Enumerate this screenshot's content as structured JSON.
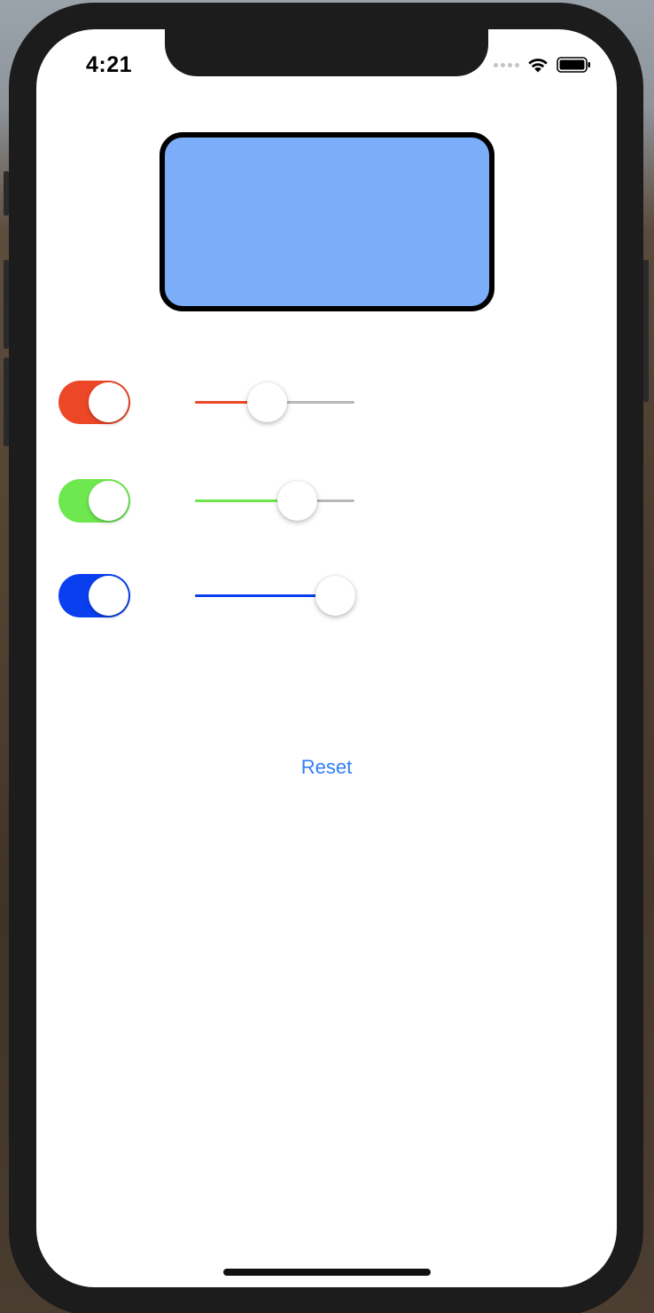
{
  "status_bar": {
    "time": "4:21",
    "signal_icon": "signal-dots-icon",
    "wifi_icon": "wifi-icon",
    "battery_icon": "battery-icon"
  },
  "preview": {
    "fill_color": "#7badf8",
    "border_color": "#000000"
  },
  "controls": [
    {
      "name": "red",
      "toggle_on": true,
      "accent_color": "#ec4727",
      "slider_value": 0.45
    },
    {
      "name": "green",
      "toggle_on": true,
      "accent_color": "#6de84f",
      "slider_value": 0.64
    },
    {
      "name": "blue",
      "toggle_on": true,
      "accent_color": "#0a3ff0",
      "slider_value": 0.88
    }
  ],
  "reset_label": "Reset",
  "colors": {
    "link_blue": "#2f7ef6",
    "slider_track": "#b8b8b8"
  }
}
